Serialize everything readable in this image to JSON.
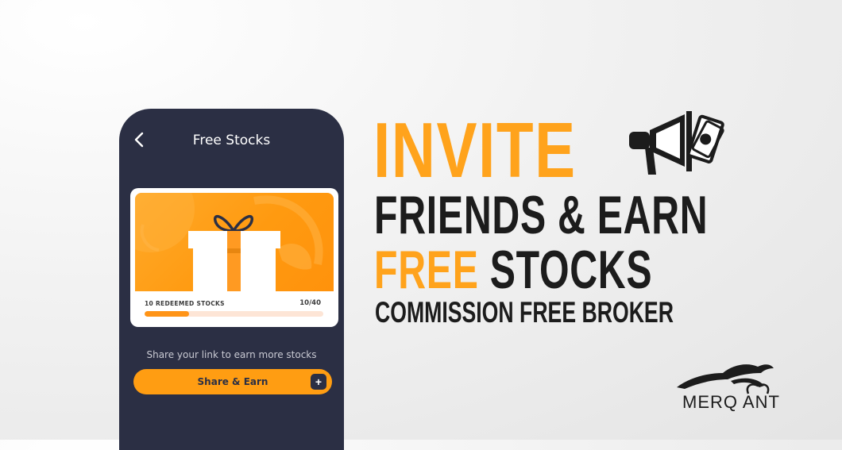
{
  "phone": {
    "title": "Free Stocks",
    "card": {
      "progress_label": "10 REDEEMED STOCKS",
      "progress_count": "10/40",
      "progress_fraction": 0.25
    },
    "share_text": "Share your link to earn more stocks",
    "share_button_label": "Share & Earn",
    "plus_label": "+"
  },
  "headline": {
    "line1": "INVITE",
    "line2": "FRIENDS & EARN",
    "line3_accent": "FREE",
    "line3_rest": " STOCKS",
    "line4": "COMMISSION FREE BROKER"
  },
  "logo": {
    "text": "MERQ ANT"
  },
  "colors": {
    "accent": "#ffa31c",
    "phone_bg": "#2b2f44",
    "dark_text": "#1c1c1c"
  }
}
